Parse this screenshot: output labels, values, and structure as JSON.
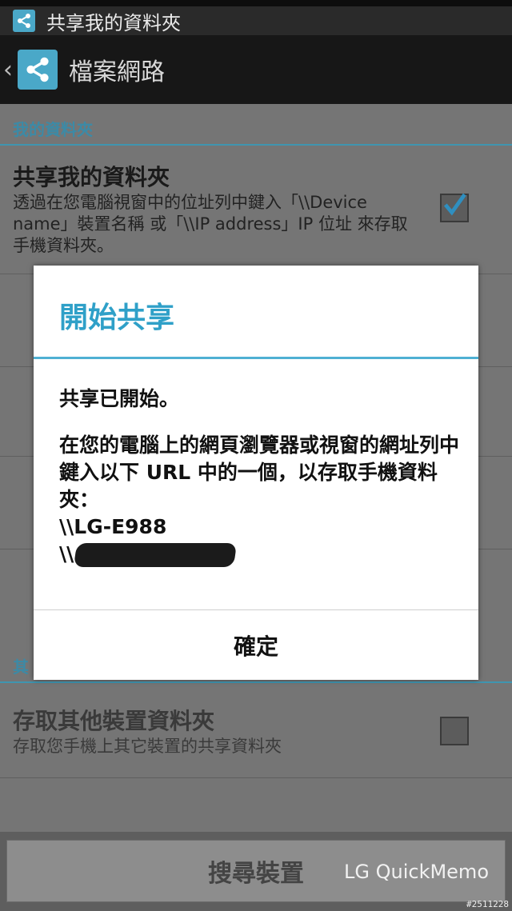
{
  "notification": {
    "text": "共享我的資料夾"
  },
  "actionbar": {
    "title": "檔案網路"
  },
  "section_mine": {
    "header": "我的資料夾"
  },
  "share_pref": {
    "title": "共享我的資料夾",
    "summary": "透過在您電腦視窗中的位址列中鍵入「\\\\Device name」裝置名稱 或「\\\\IP address」IP 位址 來存取手機資料夾。",
    "checked": true
  },
  "section_other": {
    "header_partial": "其"
  },
  "other_pref": {
    "title": "存取其他裝置資料夾",
    "summary": "存取您手機上其它裝置的共享資料夾",
    "checked": false
  },
  "bottom": {
    "search_label": "搜尋裝置"
  },
  "dialog": {
    "title": "開始共享",
    "line1": "共享已開始。",
    "line2": "在您的電腦上的網頁瀏覽器或視窗的網址列中鍵入以下 URL 中的一個，以存取手機資料夾：",
    "url1": "\\\\LG-E988",
    "url2_prefix": "\\\\",
    "ok_label": "確定"
  },
  "overlay": {
    "watermark": "LG QuickMemo",
    "stamp": "#2511228"
  },
  "colors": {
    "accent": "#2fa0c8",
    "divider": "#4eb0d3"
  }
}
